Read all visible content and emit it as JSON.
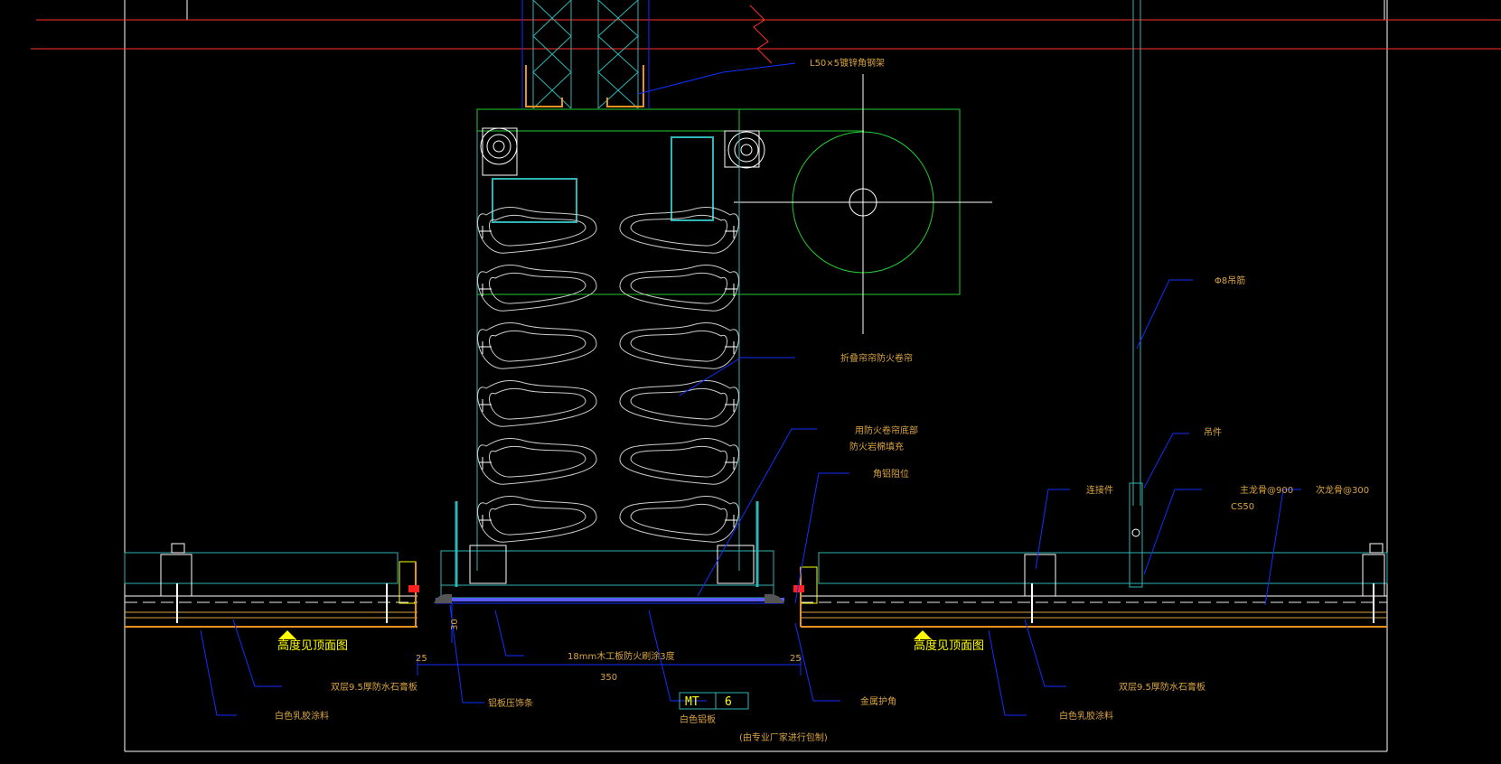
{
  "drawing": {
    "background": "#000000",
    "colors": {
      "frame": "#ffffff",
      "redline": "#ff3030",
      "cyan": "#2fb5b5",
      "green": "#22cc33",
      "leader": "#1030ff",
      "annotation": "#d9a441",
      "yellow": "#ffff00",
      "orange": "#e89020"
    },
    "labels": {
      "angle_steel": "L50×5镀锌角钢架",
      "hanger_rod": "Φ8吊筋",
      "fire_curtain": "折叠帘帘防火卷帘",
      "fire_seal_1": "用防火卷帘底部",
      "fire_seal_2": "防火岩棉填充",
      "angle_trim": "角铝阻位",
      "hanger": "吊件",
      "connector": "连接件",
      "main_keel": "主龙骨@900",
      "main_keel_code": "CS50",
      "sub_keel": "次龙骨@300",
      "height_ref_left": "高度见顶面图",
      "height_ref_right": "高度见顶面图",
      "board_left": "双层9.5厚防水石膏板",
      "board_right": "双层9.5厚防水石膏板",
      "paint_left": "白色乳胶涂料",
      "paint_right": "白色乳胶涂料",
      "wood_board": "18mm木工板防火刷涂3度",
      "aluminum_strip": "铝板压饰条",
      "metal_trim": "金属护角",
      "dim_30": "30",
      "dim_25_left": "25",
      "dim_25_right": "25",
      "dim_350": "350",
      "tag_code": "MT",
      "tag_number": "6",
      "tag_desc": "白色铝板",
      "tag_note": "(由专业厂家进行包制)"
    }
  }
}
